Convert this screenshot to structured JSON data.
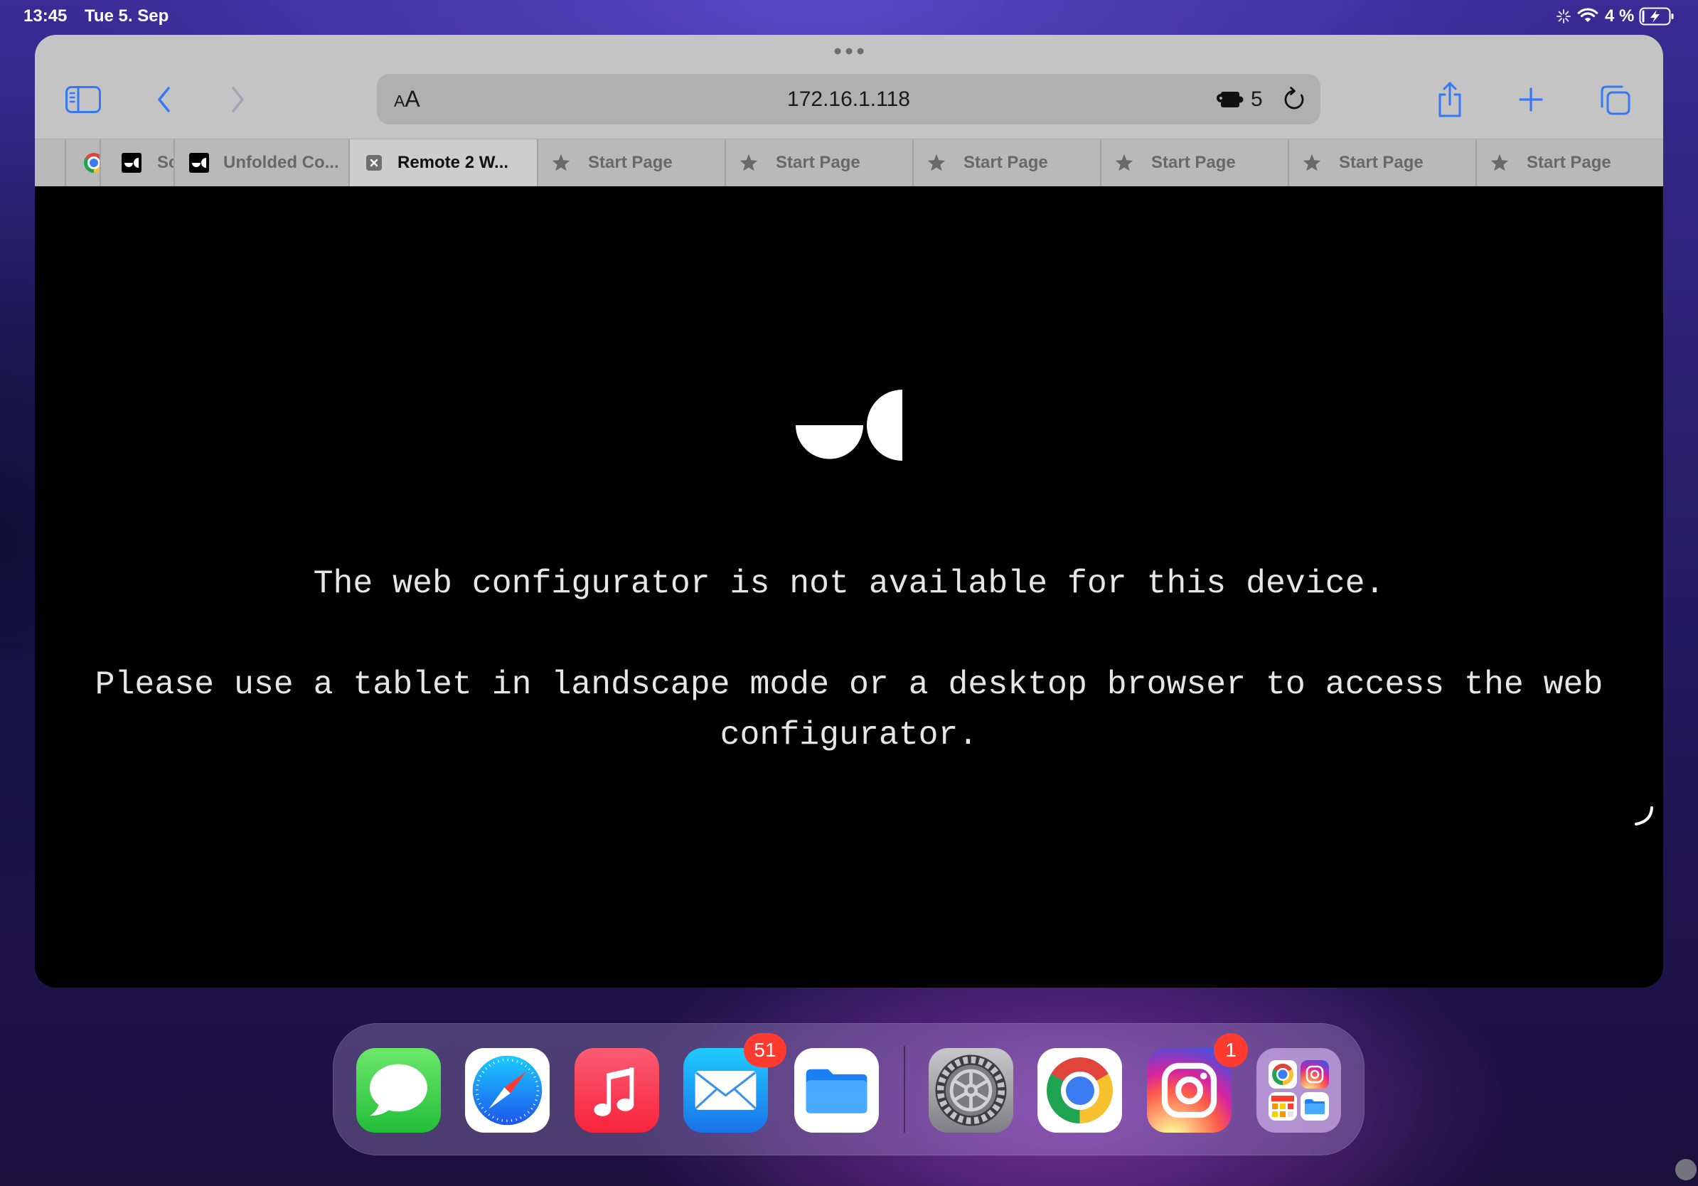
{
  "status_bar": {
    "time": "13:45",
    "date": "Tue 5. Sep",
    "battery_percent": "4 %",
    "icons": [
      "activity-spinner-icon",
      "wifi-icon",
      "battery-charging-icon"
    ]
  },
  "browser": {
    "toolbar": {
      "reader_label": "AA",
      "url": "172.16.1.118",
      "extension_count": "5",
      "icons": [
        "sidebar-icon",
        "back-chevron-icon",
        "forward-chevron-icon",
        "extension-icon",
        "reload-icon",
        "share-icon",
        "plus-icon",
        "tabs-overview-icon"
      ]
    },
    "tabs": [
      {
        "favicon": "chrome-icon"
      },
      {
        "title": "Sc",
        "favicon": "unfolded-circle-icon"
      },
      {
        "title": "Unfolded Co...",
        "favicon": "unfolded-circle-icon"
      },
      {
        "title": "Remote 2 W...",
        "favicon": "close-tab-icon",
        "active": true
      },
      {
        "title": "Start Page",
        "favicon": "star-icon"
      },
      {
        "title": "Start Page",
        "favicon": "star-icon"
      },
      {
        "title": "Start Page",
        "favicon": "star-icon"
      },
      {
        "title": "Start Page",
        "favicon": "star-icon"
      },
      {
        "title": "Start Page",
        "favicon": "star-icon"
      },
      {
        "title": "Start Page",
        "favicon": "star-icon"
      }
    ],
    "accent_color": "#3478f6"
  },
  "page": {
    "logo": "unfolded-circle-logo",
    "message": "The web configurator is not available for this device.",
    "instruction": "Please use a tablet in landscape mode or a desktop browser to access the web configurator."
  },
  "dock": {
    "apps": [
      {
        "icon": "messages-app-icon"
      },
      {
        "icon": "safari-app-icon"
      },
      {
        "icon": "music-app-icon"
      },
      {
        "icon": "mail-app-icon",
        "badge": "51"
      },
      {
        "icon": "files-app-icon"
      },
      {
        "icon": "settings-app-icon"
      },
      {
        "icon": "chrome-app-icon"
      },
      {
        "icon": "instagram-app-icon",
        "badge": "1"
      },
      {
        "icon": "app-folder-icon"
      }
    ],
    "badge_color": "#ff3b30"
  }
}
